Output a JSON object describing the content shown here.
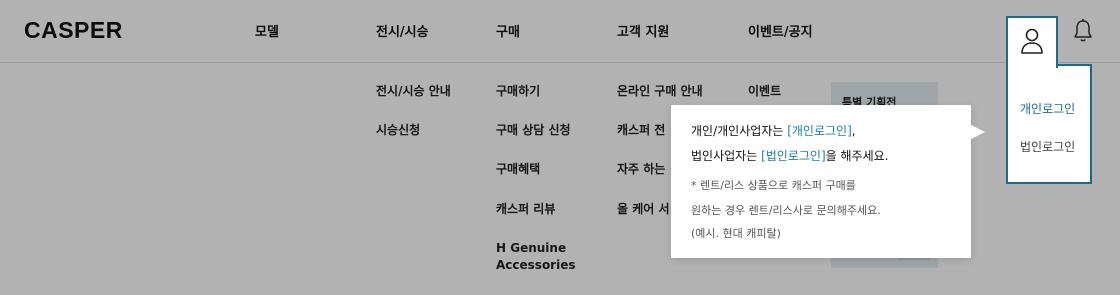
{
  "header": {
    "logo": "CASPER",
    "nav": [
      "모델",
      "전시/시승",
      "구매",
      "고객 지원",
      "이벤트/공지"
    ]
  },
  "mega_menu": {
    "col_exhibition": [
      "전시/시승 안내",
      "시승신청"
    ],
    "col_purchase": [
      "구매하기",
      "구매 상담 신청",
      "구매혜택",
      "캐스퍼 리뷰",
      "H Genuine Accessories"
    ],
    "col_support": [
      "온라인 구매 안내",
      "캐스퍼 전",
      "자주 하는",
      "올 케어 서"
    ],
    "col_event": [
      "이벤트"
    ],
    "promo_title": "특별 기획전"
  },
  "tooltip": {
    "line1_prefix": "개인/개인사업자는 ",
    "line1_link": "[개인로그인]",
    "line1_suffix": ",",
    "line2_prefix": "법인사업자는 ",
    "line2_link": "[법인로그인]",
    "line2_suffix": "을 해주세요.",
    "note1": "* 렌트/리스 상품으로 캐스퍼 구매를",
    "note2": "원하는 경우 렌트/리스사로 문의해주세요.",
    "note3": "(예시. 현대 캐피탈)"
  },
  "login_menu": {
    "personal": "개인로그인",
    "corporate": "법인로그인"
  },
  "icons": {
    "user": "user-icon",
    "bell": "bell-icon"
  },
  "colors": {
    "accent": "#1c6b8a",
    "link": "#1c7fa6",
    "overlay": "rgba(0,0,0,0.30)"
  }
}
